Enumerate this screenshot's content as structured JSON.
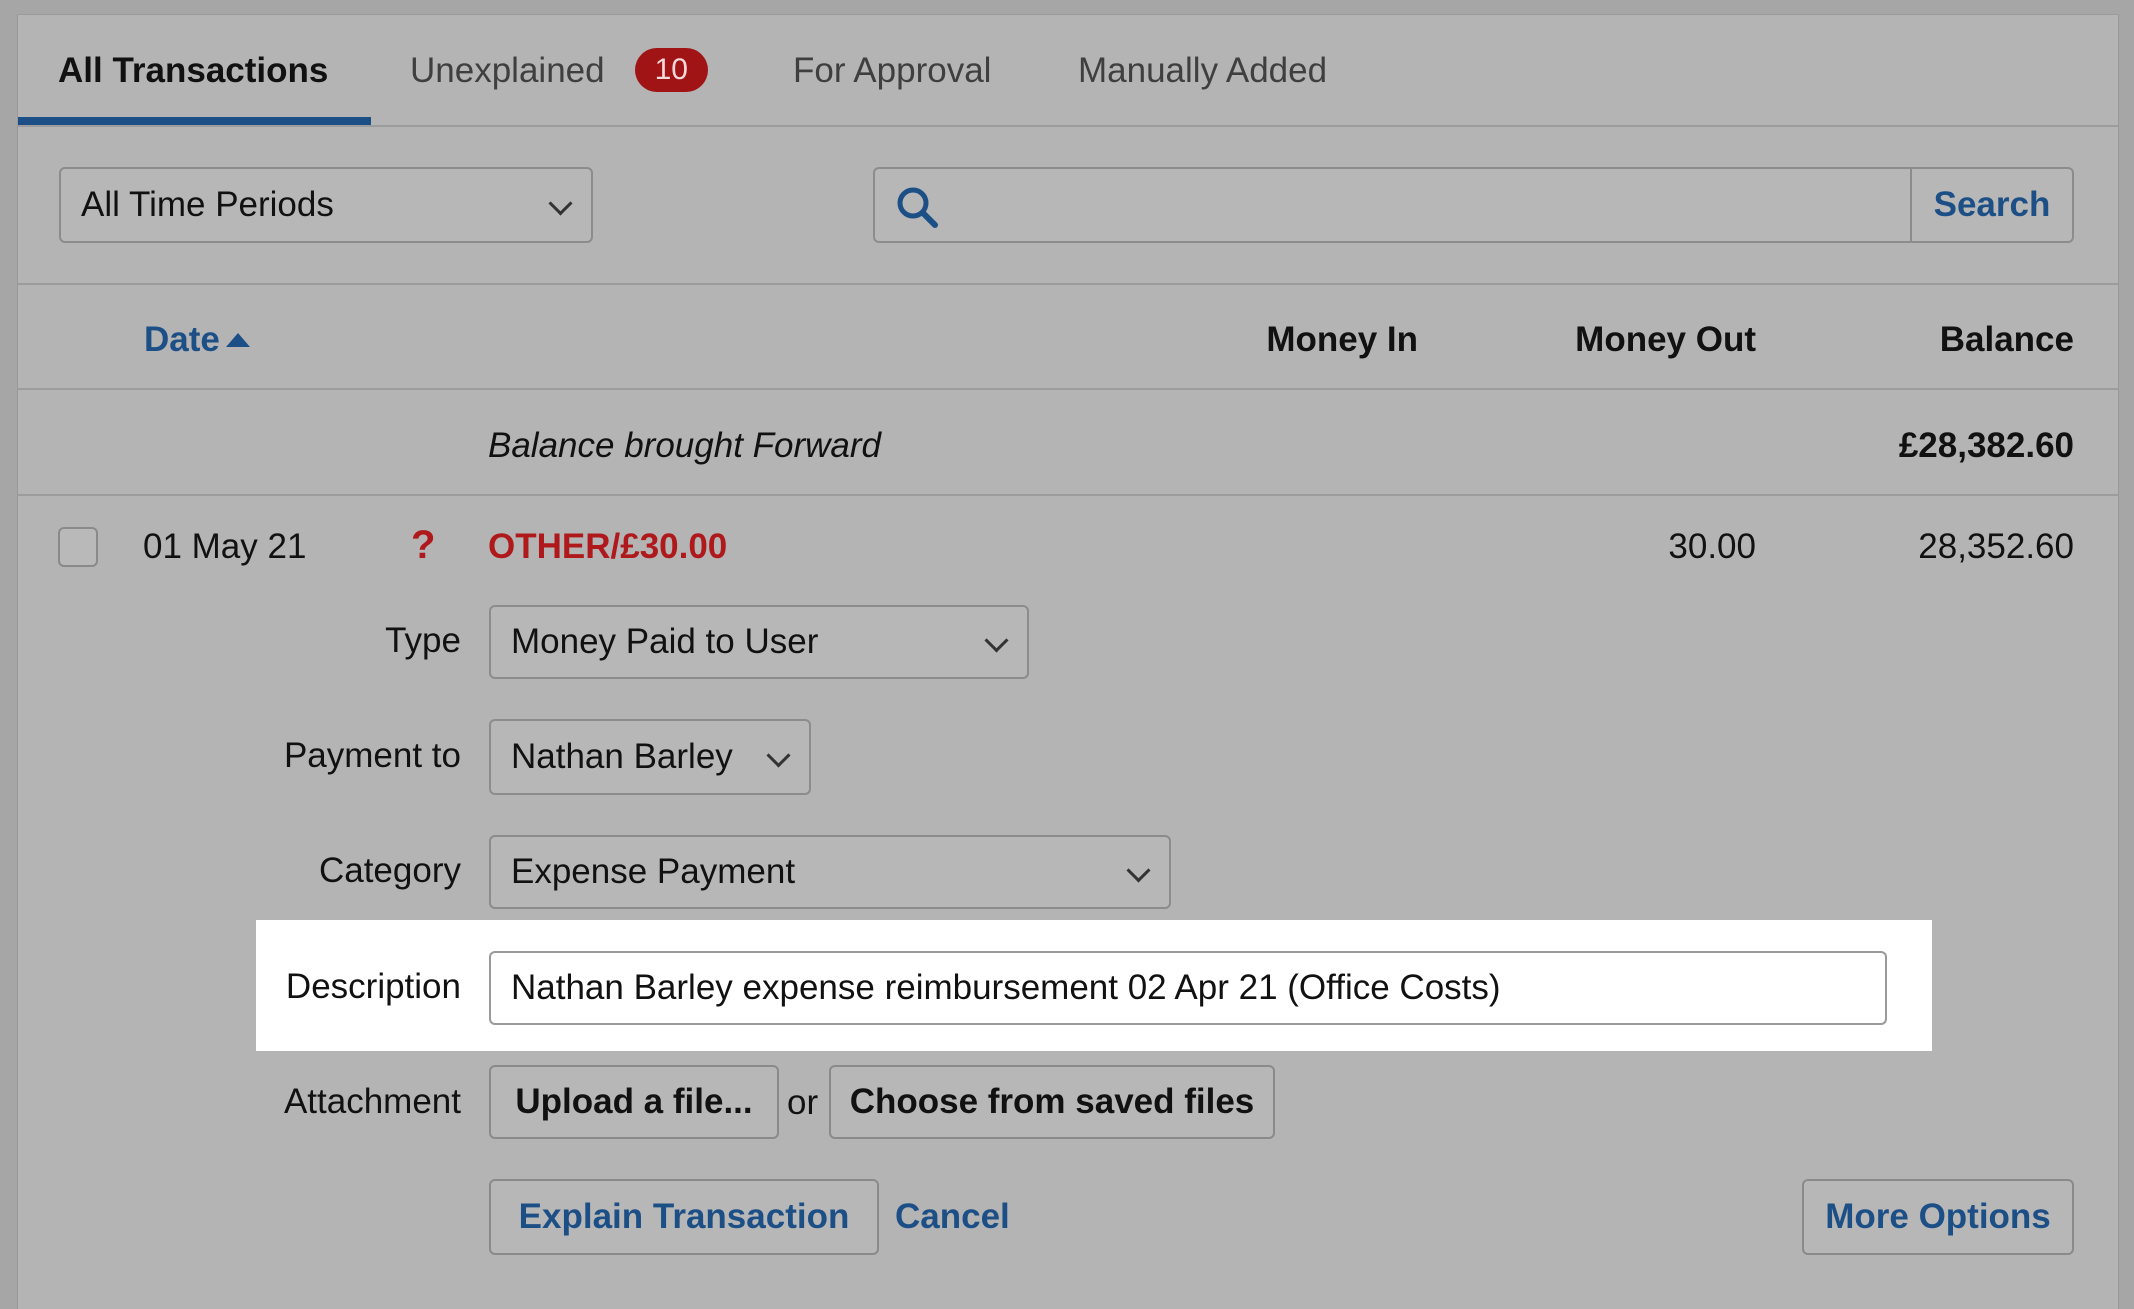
{
  "tabs": [
    {
      "label": "All Transactions"
    },
    {
      "label": "Unexplained",
      "badge": "10"
    },
    {
      "label": "For Approval"
    },
    {
      "label": "Manually Added"
    }
  ],
  "filters": {
    "period": "All Time Periods",
    "search_value": "",
    "search_button": "Search"
  },
  "table": {
    "headers": {
      "date": "Date",
      "money_in": "Money In",
      "money_out": "Money Out",
      "balance": "Balance"
    },
    "brought_forward": {
      "label": "Balance brought Forward",
      "balance": "£28,382.60"
    },
    "row": {
      "date": "01 May 21",
      "flag": "?",
      "description": "OTHER/£30.00",
      "money_in": "",
      "money_out": "30.00",
      "balance": "28,352.60"
    }
  },
  "form": {
    "type_label": "Type",
    "type_value": "Money Paid to User",
    "payment_label": "Payment to",
    "payment_value": "Nathan Barley",
    "category_label": "Category",
    "category_value": "Expense Payment",
    "description_label": "Description",
    "description_value": "Nathan Barley expense reimbursement 02 Apr 21 (Office Costs)",
    "attachment_label": "Attachment",
    "upload_button": "Upload a file...",
    "or_text": "or",
    "choose_button": "Choose from saved files",
    "explain_button": "Explain Transaction",
    "cancel_link": "Cancel",
    "more_options_button": "More Options"
  },
  "colors": {
    "accent": "#1d4f87",
    "alert": "#b0191c",
    "badge": "#a01416",
    "highlight": "#ffffff"
  },
  "icons": {
    "search": "search-icon",
    "sort": "sort-ascending-icon",
    "flag": "question-mark-icon",
    "dropdown": "chevron-down-icon"
  }
}
